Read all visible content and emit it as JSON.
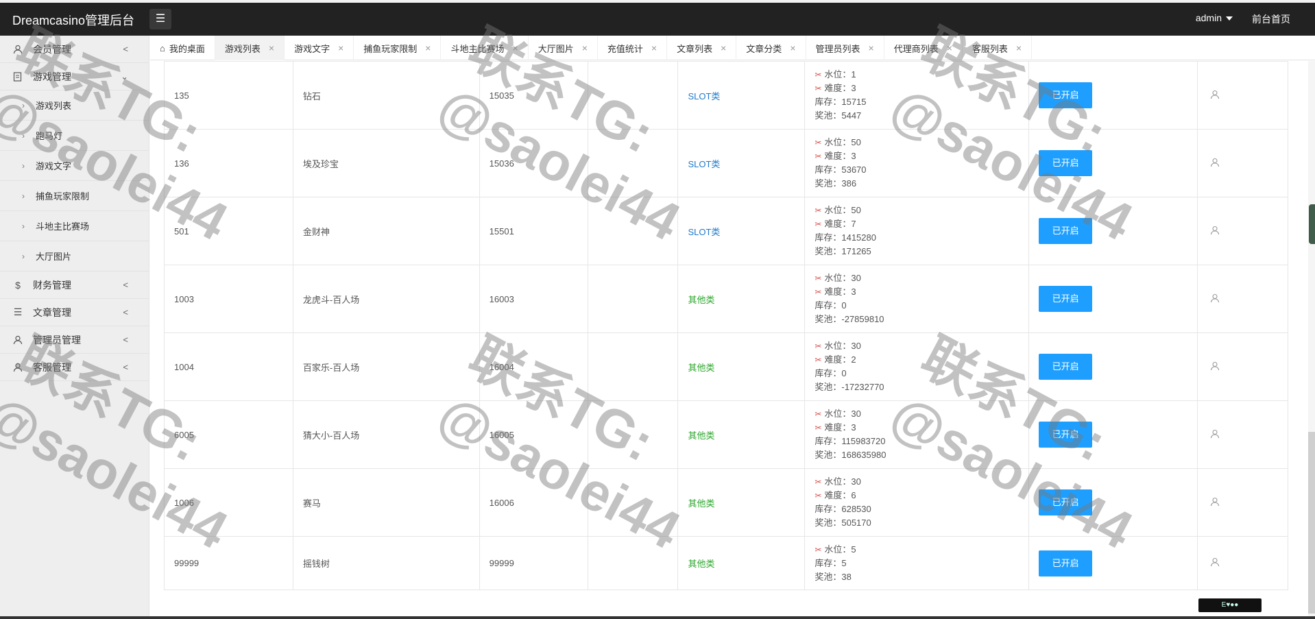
{
  "header": {
    "brand": "Dreamcasino管理后台",
    "user": "admin",
    "home_link": "前台首页"
  },
  "sidebar": {
    "groups": [
      {
        "label": "会员管理",
        "icon": "user-icon"
      },
      {
        "label": "游戏管理",
        "icon": "game-icon"
      },
      {
        "label": "财务管理",
        "icon": "dollar-icon"
      },
      {
        "label": "文章管理",
        "icon": "list-icon"
      },
      {
        "label": "管理员管理",
        "icon": "admin-icon"
      },
      {
        "label": "客服管理",
        "icon": "support-icon"
      }
    ],
    "game_items": [
      "游戏列表",
      "跑马灯",
      "游戏文字",
      "捕鱼玩家限制",
      "斗地主比赛场",
      "大厅图片"
    ]
  },
  "tabs": [
    {
      "label": "我的桌面",
      "closable": false,
      "icon": "home-icon"
    },
    {
      "label": "游戏列表",
      "closable": true,
      "active": true
    },
    {
      "label": "游戏文字",
      "closable": true
    },
    {
      "label": "捕鱼玩家限制",
      "closable": true
    },
    {
      "label": "斗地主比赛场",
      "closable": true
    },
    {
      "label": "大厅图片",
      "closable": true
    },
    {
      "label": "充值统计",
      "closable": true
    },
    {
      "label": "文章列表",
      "closable": true
    },
    {
      "label": "文章分类",
      "closable": true
    },
    {
      "label": "管理员列表",
      "closable": true
    },
    {
      "label": "代理商列表",
      "closable": true
    },
    {
      "label": "客服列表",
      "closable": true
    }
  ],
  "labels": {
    "water": "水位：",
    "difficulty": "难度：",
    "stock": "库存：",
    "pool": "奖池：",
    "status_btn": "已开启"
  },
  "rows": [
    {
      "id": "135",
      "name": "钻石",
      "code": "15035",
      "category": "SLOT类",
      "cat_type": "slot",
      "water": "1",
      "difficulty": "3",
      "stock": "15715",
      "pool": "5447"
    },
    {
      "id": "136",
      "name": "埃及珍宝",
      "code": "15036",
      "category": "SLOT类",
      "cat_type": "slot",
      "water": "50",
      "difficulty": "3",
      "stock": "53670",
      "pool": "386"
    },
    {
      "id": "501",
      "name": "金财神",
      "code": "15501",
      "category": "SLOT类",
      "cat_type": "slot",
      "water": "50",
      "difficulty": "7",
      "stock": "1415280",
      "pool": "171265"
    },
    {
      "id": "1003",
      "name": "龙虎斗-百人场",
      "code": "16003",
      "category": "其他类",
      "cat_type": "other",
      "water": "30",
      "difficulty": "3",
      "stock": "0",
      "pool": "-27859810"
    },
    {
      "id": "1004",
      "name": "百家乐-百人场",
      "code": "16004",
      "category": "其他类",
      "cat_type": "other",
      "water": "30",
      "difficulty": "2",
      "stock": "0",
      "pool": "-17232770"
    },
    {
      "id": "6005",
      "name": "猜大小-百人场",
      "code": "16005",
      "category": "其他类",
      "cat_type": "other",
      "water": "30",
      "difficulty": "3",
      "stock": "115983720",
      "pool": "168635980"
    },
    {
      "id": "1006",
      "name": "赛马",
      "code": "16006",
      "category": "其他类",
      "cat_type": "other",
      "water": "30",
      "difficulty": "6",
      "stock": "628530",
      "pool": "505170"
    },
    {
      "id": "99999",
      "name": "摇钱树",
      "code": "99999",
      "category": "其他类",
      "cat_type": "other",
      "water": "5",
      "difficulty": null,
      "stock": "5",
      "pool": "38"
    }
  ],
  "watermark": {
    "line1": "联系TG:",
    "line2": "@saolei44"
  },
  "badge": "E♥●●"
}
